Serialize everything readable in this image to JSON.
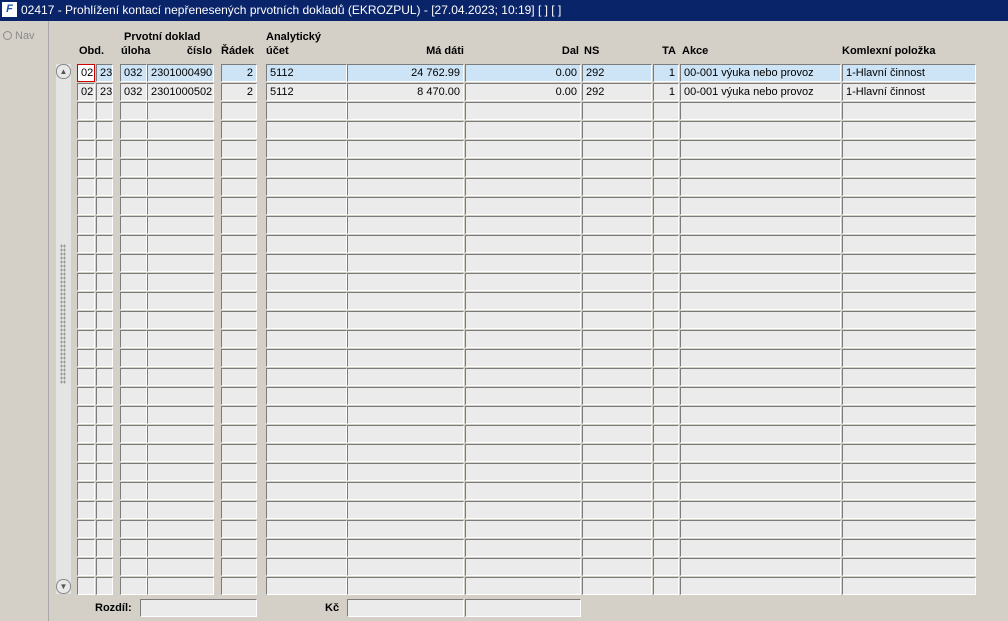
{
  "window": {
    "icon_label": "F",
    "title": "02417 - Prohlížení kontací nepřenesených prvotních dokladů (EKROZPUL) - [27.04.2023; 10:19]  [ ]  [ ]"
  },
  "side": {
    "nav_label": "Nav"
  },
  "headers": {
    "obd": "Obd.",
    "prvotni_doklad": "Prvotní doklad",
    "uloha": "úloha",
    "cislo": "číslo",
    "radek": "Řádek",
    "analyticky": "Analytický",
    "ucet": "účet",
    "ma_dati": "Má dáti",
    "dal": "Dal",
    "ns": "NS",
    "ta": "TA",
    "akce": "Akce",
    "komplexni": "Komlexní položka"
  },
  "rows": [
    {
      "obd_m": "02",
      "obd_y": "23",
      "uloha": "032",
      "cislo": "2301000490",
      "radek": "2",
      "ucet": "5112",
      "ma_dati": "24 762.99",
      "dal": "0.00",
      "ns": "292",
      "ta": "1",
      "akce": "00-001 výuka nebo provoz",
      "komplexni": "1-Hlavní činnost"
    },
    {
      "obd_m": "02",
      "obd_y": "23",
      "uloha": "032",
      "cislo": "2301000502",
      "radek": "2",
      "ucet": "5112",
      "ma_dati": "8 470.00",
      "dal": "0.00",
      "ns": "292",
      "ta": "1",
      "akce": "00-001 výuka nebo provoz",
      "komplexni": "1-Hlavní činnost"
    }
  ],
  "empty_rows": 26,
  "footer": {
    "rozdil_label": "Rozdíl:",
    "kc_label": "Kč"
  },
  "icons": {
    "scroll_up": "triangle-up-icon",
    "scroll_down": "triangle-down-icon"
  },
  "colors": {
    "titlebar": "#0a246a",
    "active_row": "#cde4f6",
    "field": "#ebebeb",
    "focus_border": "#d00000"
  }
}
